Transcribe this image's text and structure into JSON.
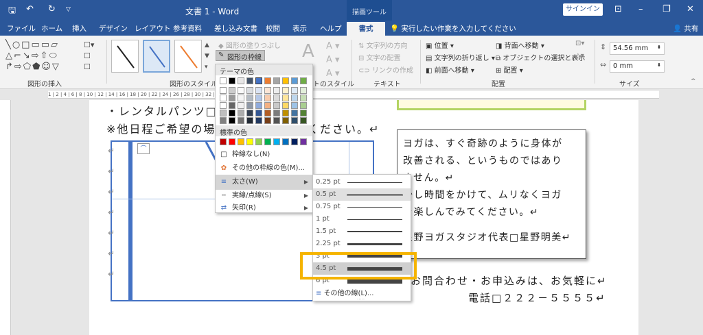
{
  "titlebar": {
    "doc_title": "文書 1  -  Word",
    "context_group": "描画ツール",
    "signin": "サインイン"
  },
  "tabs": [
    "ファイル",
    "ホーム",
    "挿入",
    "デザイン",
    "レイアウト",
    "参考資料",
    "差し込み文書",
    "校閲",
    "表示",
    "ヘルプ"
  ],
  "active_tab": "書式",
  "tellme": "実行したい作業を入力してください",
  "share": "共有",
  "ribbon": {
    "group_insert": "図形の挿入",
    "group_styles": "図形のスタイル",
    "fill_label": "図形の塗りつぶし",
    "outline_label": "図形の枠線",
    "wordart_label": "トのスタイル",
    "text_dir": "文字列の方向",
    "text_align": "文字の配置",
    "link": "リンクの作成",
    "group_text": "テキスト",
    "position": "位置",
    "wrap": "文字列の折り返し",
    "bring_forward": "前面へ移動",
    "send_back": "背面へ移動",
    "selection": "オブジェクトの選択と表示",
    "align": "配置",
    "group_arrange": "配置",
    "group_size": "サイズ",
    "height": "54.56 mm",
    "width": "0 mm"
  },
  "ruler": "1 | 2 | 4 | 6 | 8 | 10 | 12 | 14 | 16 | 18 | 20 | 22 | 24 | 26 | 28 | 30 | 32 | 34 | 36 | 38 | 40 | 41 | 42 | 43 | 44",
  "document": {
    "line1": "・レンタルパンツ□",
    "line2": "※他日程ご希望の場",
    "line2_tail": "せください。↵",
    "textbox": [
      "ヨガは、すぐ奇跡のように身体が",
      "改善される、というものではあり",
      "ません。↵",
      "少し時間をかけて、ムリなくヨガ",
      "を楽しんでみてください。↵",
      "",
      "星野ヨガスタジオ代表□星野明美↵"
    ],
    "inquiry": "お問合わせ・お申込みは、お気軽に↵",
    "phone": "電話□２２２－５５５５↵"
  },
  "color_menu": {
    "theme_header": "テーマの色",
    "standard_header": "標準の色",
    "theme_colors": [
      "#ffffff",
      "#000000",
      "#e7e6e6",
      "#44546a",
      "#4472c4",
      "#ed7d31",
      "#a5a5a5",
      "#ffc000",
      "#5b9bd5",
      "#70ad47"
    ],
    "standard_colors": [
      "#c00000",
      "#ff0000",
      "#ffc000",
      "#ffff00",
      "#92d050",
      "#00b050",
      "#00b0f0",
      "#0070c0",
      "#002060",
      "#7030a0"
    ],
    "no_line": "枠線なし(N)",
    "more_colors": "その他の枠線の色(M)...",
    "weight": "太さ(W)",
    "dashes": "実線/点線(S)",
    "arrows": "矢印(R)"
  },
  "weights": [
    {
      "label": "0.25 pt",
      "pt": 0.25
    },
    {
      "label": "0.5 pt",
      "pt": 0.5
    },
    {
      "label": "0.75 pt",
      "pt": 0.75
    },
    {
      "label": "1 pt",
      "pt": 1
    },
    {
      "label": "1.5 pt",
      "pt": 1.5
    },
    {
      "label": "2.25 pt",
      "pt": 2.25
    },
    {
      "label": "3 pt",
      "pt": 3
    },
    {
      "label": "4.5 pt",
      "pt": 4.5
    },
    {
      "label": "6 pt",
      "pt": 6
    }
  ],
  "selected_weight": "4.5 pt",
  "more_lines": "その他の線(L)...",
  "colors": {
    "accent": "#2b579a",
    "highlight": "#f5b400"
  }
}
